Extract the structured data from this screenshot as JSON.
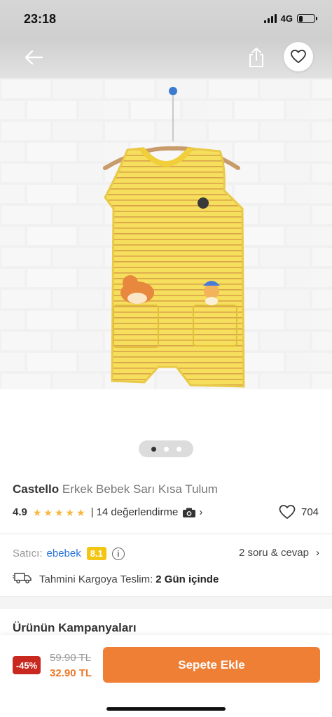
{
  "status_bar": {
    "time": "23:18",
    "network": "4G"
  },
  "nav": {
    "back_icon": "arrow-left-icon",
    "share_icon": "share-icon",
    "favorite_icon": "heart-icon"
  },
  "gallery": {
    "image_description": "yellow striped baby romper",
    "dots_count": 3,
    "active_dot": 0
  },
  "product": {
    "brand": "Castello",
    "name": "Erkek Bebek Sarı Kısa Tulum",
    "rating": "4.9",
    "stars": 5,
    "separator": "|",
    "reviews_text": "14 değerlendirme",
    "favorites_count": "704"
  },
  "seller": {
    "label": "Satıcı:",
    "name": "ebebek",
    "score": "8.1",
    "qa_text": "2 soru & cevap"
  },
  "delivery": {
    "label": "Tahmini Kargoya Teslim:",
    "value": "2 Gün içinde"
  },
  "campaigns": {
    "title": "Ürünün Kampanyaları"
  },
  "purchase": {
    "discount": "-45%",
    "old_price": "59.90 TL",
    "new_price": "32.90 TL",
    "add_to_cart": "Sepete Ekle"
  },
  "colors": {
    "accent": "#ee7f35",
    "discount": "#c9281e",
    "link": "#2a73d8",
    "score_badge": "#f3c613",
    "star": "#f6b73c"
  }
}
